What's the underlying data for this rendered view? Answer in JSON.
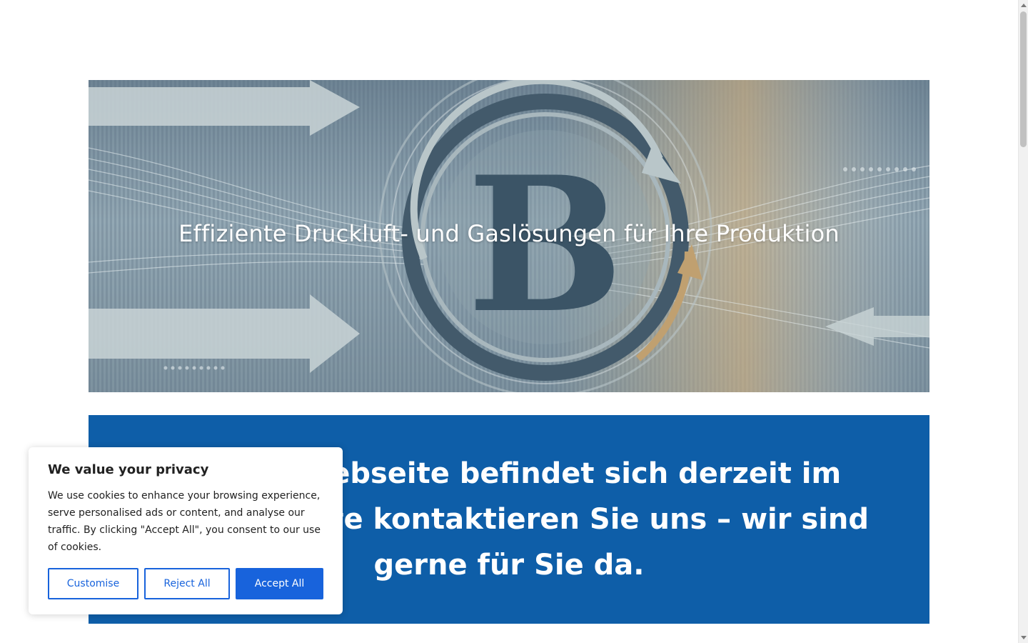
{
  "hero": {
    "title": "Effiziente Druckluft- und Gaslösungen für Ihre Produktion",
    "logo_letter": "B"
  },
  "banner": {
    "text": "Unsere Webseite befindet sich derzeit im Aufbau. Bitte kontaktieren Sie uns – wir sind gerne für Sie da."
  },
  "cookie_banner": {
    "title": "We value your privacy",
    "text": "We use cookies to enhance your browsing experience, serve personalised ads or content, and analyse our traffic. By clicking \"Accept All\", you consent to our use of cookies.",
    "customise_label": "Customise",
    "reject_label": "Reject All",
    "accept_label": "Accept All"
  },
  "colors": {
    "banner_bg": "#0e5ea8",
    "accent": "#1863dc"
  }
}
